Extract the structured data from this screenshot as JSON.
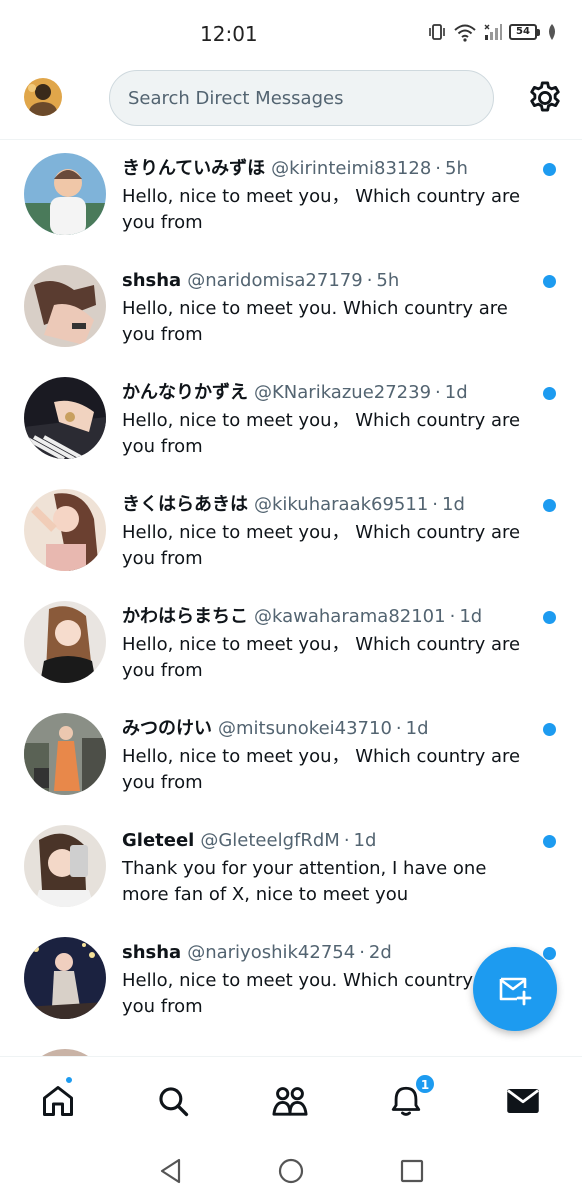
{
  "status_bar": {
    "time": "12:01",
    "battery": "54"
  },
  "search": {
    "placeholder": "Search Direct Messages"
  },
  "conversations": [
    {
      "name": "きりんていみずほ",
      "handle": "@kirinteimi83128",
      "time": "5h",
      "message": "Hello, nice to meet you，  Which country are you from",
      "unread": true
    },
    {
      "name": "shsha",
      "handle": "@naridomisa27179",
      "time": "5h",
      "message": "Hello, nice to meet you. Which country are you from",
      "unread": true
    },
    {
      "name": "かんなりかずえ",
      "handle": "@KNarikazue27239",
      "time": "1d",
      "message": "Hello, nice to meet you，  Which country are you from",
      "unread": true
    },
    {
      "name": "きくはらあきは",
      "handle": "@kikuharaak69511",
      "time": "1d",
      "message": "Hello, nice to meet you，  Which country are you from",
      "unread": true
    },
    {
      "name": "かわはらまちこ",
      "handle": "@kawaharama82101",
      "time": "1d",
      "message": "Hello, nice to meet you，  Which country are you from",
      "unread": true
    },
    {
      "name": "みつのけい",
      "handle": "@mitsunokei43710",
      "time": "1d",
      "message": "Hello, nice to meet you，  Which country are you from",
      "unread": true
    },
    {
      "name": "Gleteel",
      "handle": "@GleteelgfRdM",
      "time": "1d",
      "message": "Thank you for your attention, I have one more fan of X, nice to meet you",
      "unread": true
    },
    {
      "name": "shsha",
      "handle": "@nariyoshik42754",
      "time": "2d",
      "message": "Hello, nice to meet you. Which country are you from",
      "unread": true
    }
  ],
  "bottom_nav": {
    "notifications_count": "1"
  },
  "colors": {
    "accent": "#1d9bf0",
    "text_primary": "#0f1419",
    "text_secondary": "#536471"
  }
}
